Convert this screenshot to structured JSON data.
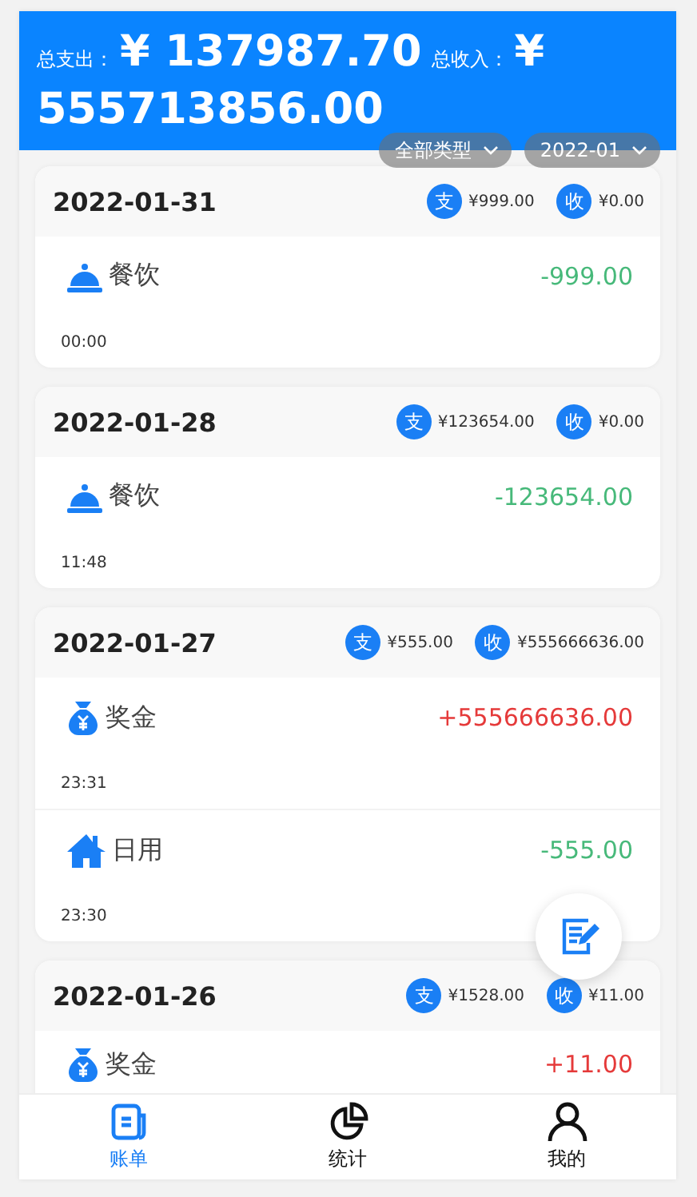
{
  "summary": {
    "expense_label": "总支出：",
    "expense": "¥ 137987.70",
    "income_label": "总收入：",
    "income": "¥ 555713856.00"
  },
  "filters": [
    {
      "label": "全部类型"
    },
    {
      "label": "2022-01"
    }
  ],
  "days": [
    {
      "date": "2022-01-31",
      "expense_badge": "支",
      "expense": "¥999.00",
      "income_badge": "收",
      "income": "¥0.00",
      "items": [
        {
          "kind": "dining",
          "category": "餐饮",
          "color": "#47b97a",
          "amount": "-999.00",
          "time": "00:00"
        }
      ]
    },
    {
      "date": "2022-01-28",
      "expense_badge": "支",
      "expense": "¥123654.00",
      "income_badge": "收",
      "income": "¥0.00",
      "items": [
        {
          "kind": "dining",
          "category": "餐饮",
          "color": "#47b97a",
          "amount": "-123654.00",
          "time": "11:48"
        }
      ]
    },
    {
      "date": "2022-01-27",
      "expense_badge": "支",
      "expense": "¥555.00",
      "income_badge": "收",
      "income": "¥555666636.00",
      "items": [
        {
          "kind": "bonus",
          "category": "奖金",
          "color": "#e53a3a",
          "amount": "+555666636.00",
          "time": "23:31"
        },
        {
          "kind": "home",
          "category": "日用",
          "color": "#47b97a",
          "amount": "-555.00",
          "time": "23:30"
        }
      ]
    },
    {
      "date": "2022-01-26",
      "expense_badge": "支",
      "expense": "¥1528.00",
      "income_badge": "收",
      "income": "¥11.00",
      "items": [
        {
          "kind": "bonus",
          "category": "奖金",
          "color": "#e53a3a",
          "amount": "+11.00"
        }
      ]
    }
  ],
  "tabs": [
    {
      "kind": "bill",
      "label": "账单",
      "selected": true
    },
    {
      "kind": "stats",
      "label": "统计",
      "selected": false
    },
    {
      "kind": "profile",
      "label": "我的",
      "selected": false
    }
  ]
}
